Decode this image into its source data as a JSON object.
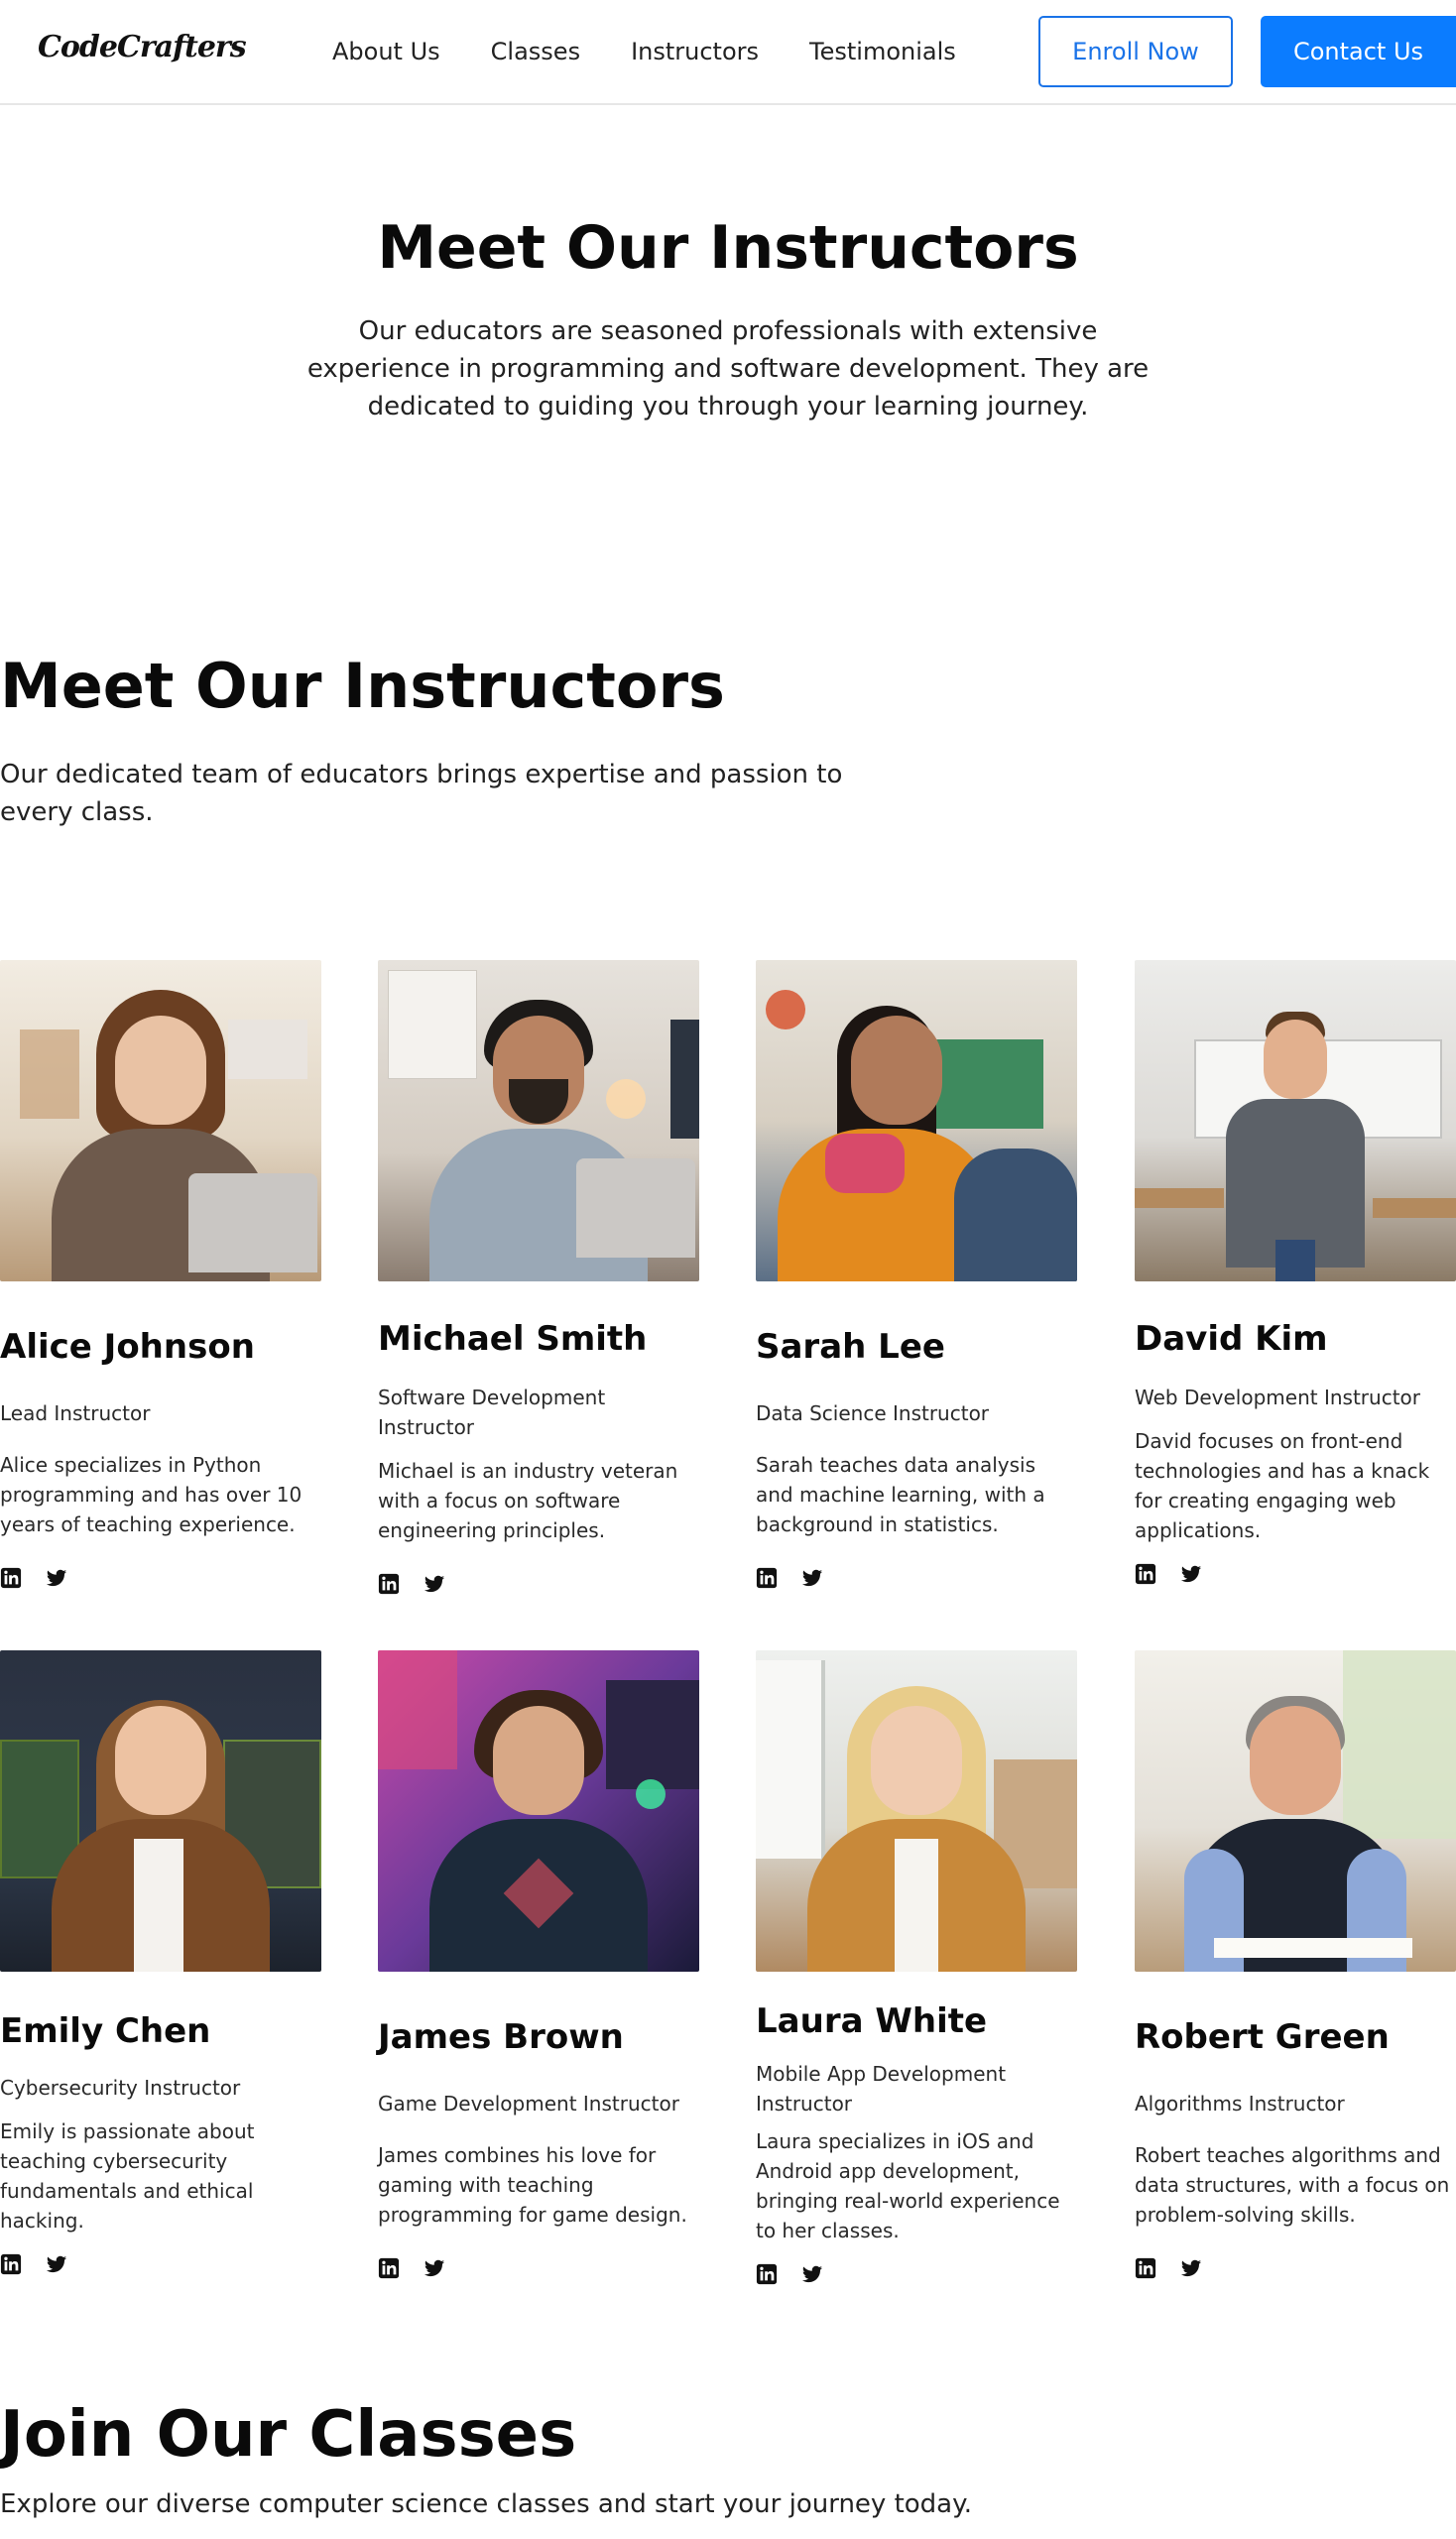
{
  "nav": {
    "logo": "CodeCrafters",
    "links": [
      "About Us",
      "Classes",
      "Instructors",
      "Testimonials"
    ],
    "enroll_label": "Enroll Now",
    "contact_label": "Contact Us"
  },
  "hero": {
    "title": "Meet Our Instructors",
    "text": "Our educators are seasoned professionals with extensive experience in programming and software development. They are dedicated to guiding you through your learning journey."
  },
  "team": {
    "title": "Meet Our Instructors",
    "text": "Our dedicated team of educators brings expertise and passion to every class."
  },
  "instructors": [
    {
      "name": "Alice Johnson",
      "role": "Lead Instructor",
      "bio": "Alice specializes in Python programming and has over 10 years of teaching experience."
    },
    {
      "name": "Michael Smith",
      "role": "Software Development Instructor",
      "bio": "Michael is an industry veteran with a focus on software engineering principles."
    },
    {
      "name": "Sarah Lee",
      "role": "Data Science Instructor",
      "bio": "Sarah teaches data analysis and machine learning, with a background in statistics."
    },
    {
      "name": "David Kim",
      "role": "Web Development Instructor",
      "bio": "David focuses on front-end technologies and has a knack for creating engaging web applications."
    },
    {
      "name": "Emily Chen",
      "role": "Cybersecurity Instructor",
      "bio": "Emily is passionate about teaching cybersecurity fundamentals and ethical hacking."
    },
    {
      "name": "James Brown",
      "role": "Game Development Instructor",
      "bio": "James combines his love for gaming with teaching programming for game design."
    },
    {
      "name": "Laura White",
      "role": "Mobile App Development Instructor",
      "bio": "Laura specializes in iOS and Android app development, bringing real-world experience to her classes."
    },
    {
      "name": "Robert Green",
      "role": "Algorithms Instructor",
      "bio": "Robert teaches algorithms and data structures, with a focus on problem-solving skills."
    }
  ],
  "icons": {
    "social": [
      "linkedin-icon",
      "twitter-icon"
    ]
  },
  "join": {
    "title": "Join Our Classes",
    "text": "Explore our diverse computer science classes and start your journey today."
  },
  "colors": {
    "accent": "#0b7cff",
    "outline": "#1a73e8"
  }
}
